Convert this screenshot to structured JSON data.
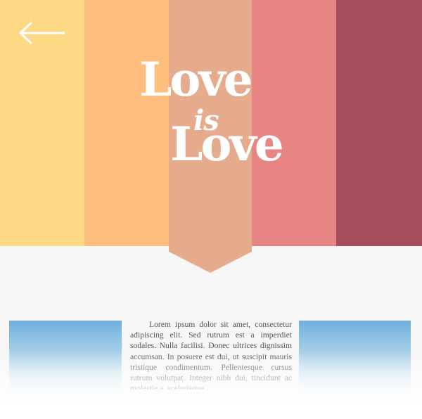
{
  "hero": {
    "stripe_colors": [
      "#fed985",
      "#fdbe7d",
      "#e6ab8c",
      "#e68583",
      "#a64d5b"
    ],
    "title_line1": "Love",
    "title_line2": "is",
    "title_line3": "Love",
    "title_color": "#ffffff"
  },
  "nav": {
    "back_icon": "arrow-left-icon"
  },
  "content": {
    "body_text": "Lorem ipsum dolor sit amet, consectetur adipiscing elit. Sed rutrum est a imperdiet sodales. Nulla facilisi. Donec ultrices dignissim accumsan. In posuere est dui, ut suscipit mauris tristique condimentum. Pellentesque cursus rutrum volutpat. Integer nibh dui, tincidunt ac molestie a, scelerisque",
    "card_color": "#6fb0dc"
  }
}
